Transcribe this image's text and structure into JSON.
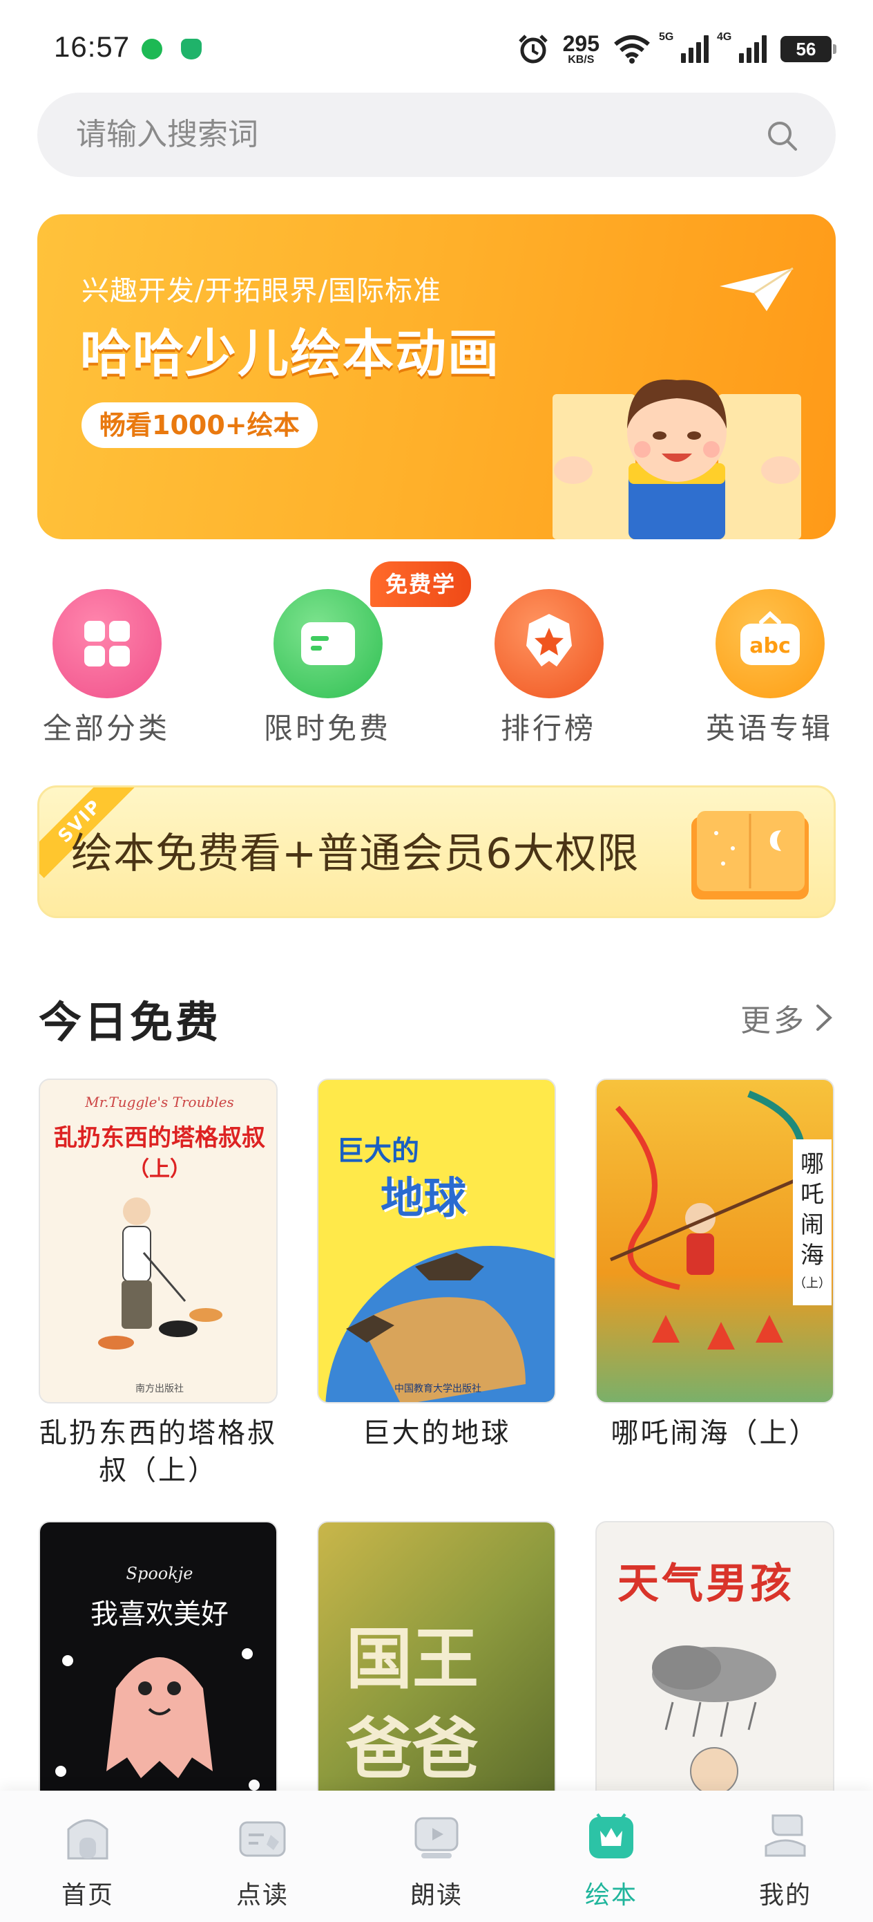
{
  "status_bar": {
    "time": "16:57",
    "speed_value": "295",
    "speed_unit": "KB/S",
    "net1": "5G",
    "net2": "4G",
    "battery": "56"
  },
  "search": {
    "placeholder": "请输入搜索词"
  },
  "banner": {
    "subtitle": "兴趣开发/开拓眼界/国际标准",
    "title": "哈哈少儿绘本动画",
    "pill": "畅看1000+绘本"
  },
  "categories": [
    {
      "label": "全部分类",
      "color": "#f25b8f"
    },
    {
      "label": "限时免费",
      "color": "#3fcc5f",
      "badge": "免费学"
    },
    {
      "label": "排行榜",
      "color": "#ff6a2a"
    },
    {
      "label": "英语专辑",
      "color": "#ffa519"
    }
  ],
  "svip": {
    "ribbon": "SVIP",
    "text": "绘本免费看+普通会员6大权限"
  },
  "section": {
    "title": "今日免费",
    "more": "更多"
  },
  "books": [
    {
      "title": "乱扔东西的塔格叔叔（上）",
      "cover_title": "乱扔东西的塔格叔叔",
      "cover_sub": "（上）",
      "cover_en": "Mr.Tuggle's Troubles",
      "publisher": "南方出版社"
    },
    {
      "title": "巨大的地球",
      "cover_title": "巨大的",
      "cover_title2": "地球",
      "publisher": "中国教育大学出版社"
    },
    {
      "title": "哪吒闹海（上）",
      "cover_title": "哪吒闹海",
      "cover_sub": "（上）"
    },
    {
      "title": "",
      "cover_title": "我喜欢美好",
      "cover_en": "Spookje"
    },
    {
      "title": "",
      "cover_title": "国王",
      "cover_title2": "爸爸"
    },
    {
      "title": "",
      "cover_title": "天气男孩"
    }
  ],
  "tabs": [
    {
      "label": "首页",
      "icon": "home-icon"
    },
    {
      "label": "点读",
      "icon": "point-read-icon"
    },
    {
      "label": "朗读",
      "icon": "read-aloud-icon"
    },
    {
      "label": "绘本",
      "icon": "picture-book-icon",
      "active": true
    },
    {
      "label": "我的",
      "icon": "profile-icon"
    }
  ],
  "colors": {
    "accent": "#20b59c",
    "banner": "#ffb02a",
    "svip_bg": "#fff2b8"
  }
}
